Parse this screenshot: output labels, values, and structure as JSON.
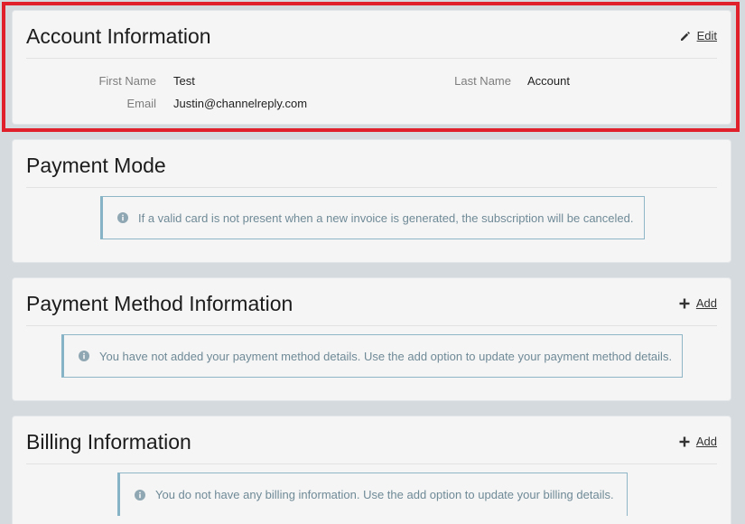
{
  "account": {
    "title": "Account Information",
    "edit_label": "Edit",
    "first_name_label": "First Name",
    "first_name_value": "Test",
    "last_name_label": "Last Name",
    "last_name_value": "Account",
    "email_label": "Email",
    "email_value": "Justin@channelreply.com"
  },
  "payment_mode": {
    "title": "Payment Mode",
    "notice": "If a valid card is not present when a new invoice is generated, the subscription will be canceled."
  },
  "payment_method": {
    "title": "Payment Method Information",
    "add_label": "Add",
    "notice": "You have not added your payment method details. Use the add option to update your payment method details."
  },
  "billing": {
    "title": "Billing Information",
    "add_label": "Add",
    "notice": "You do not have any billing information. Use the add option to update your billing details."
  },
  "colors": {
    "highlight": "#e0202b",
    "info_border": "#86b4c6",
    "info_text": "#6f8a97"
  }
}
